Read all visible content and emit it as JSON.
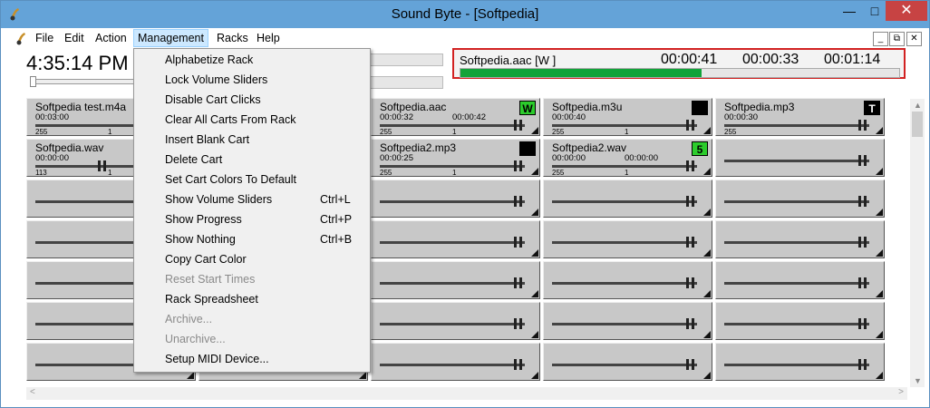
{
  "window": {
    "title": "Sound Byte - [Softpedia]"
  },
  "menubar": {
    "items": [
      "File",
      "Edit",
      "Action",
      "Management",
      "Racks",
      "Help"
    ]
  },
  "clock": {
    "time": "4:35:14 PM"
  },
  "now_playing": {
    "filename": "Softpedia.aac  [W ]",
    "elapsed": "00:00:41",
    "remaining": "00:00:33",
    "duration": "00:01:14",
    "progress": 0.55,
    "progress_color": "#12a33a",
    "border_color": "#d22222"
  },
  "management_menu": {
    "items": [
      {
        "label": "Alphabetize Rack",
        "shortcut": "",
        "enabled": true
      },
      {
        "label": "Lock Volume Sliders",
        "shortcut": "",
        "enabled": true
      },
      {
        "label": "Disable Cart Clicks",
        "shortcut": "",
        "enabled": true
      },
      {
        "label": "Clear All Carts From Rack",
        "shortcut": "",
        "enabled": true
      },
      {
        "label": "Insert Blank Cart",
        "shortcut": "",
        "enabled": true
      },
      {
        "label": "Delete Cart",
        "shortcut": "",
        "enabled": true
      },
      {
        "label": "Set Cart Colors To Default",
        "shortcut": "",
        "enabled": true
      },
      {
        "label": "Show Volume Sliders",
        "shortcut": "Ctrl+L",
        "enabled": true
      },
      {
        "label": "Show Progress",
        "shortcut": "Ctrl+P",
        "enabled": true
      },
      {
        "label": "Show Nothing",
        "shortcut": "Ctrl+B",
        "enabled": true
      },
      {
        "label": "Copy Cart Color",
        "shortcut": "",
        "enabled": true
      },
      {
        "label": "Reset Start Times",
        "shortcut": "",
        "enabled": false
      },
      {
        "label": "Rack Spreadsheet",
        "shortcut": "",
        "enabled": true
      },
      {
        "label": "Archive...",
        "shortcut": "",
        "enabled": false
      },
      {
        "label": "Unarchive...",
        "shortcut": "",
        "enabled": false
      },
      {
        "label": "Setup MIDI Device...",
        "shortcut": "",
        "enabled": true
      }
    ]
  },
  "carts": [
    {
      "name": "Softpedia test.m4a",
      "t1": "00:03:00",
      "t2": "",
      "vmin": "255",
      "vmax": "1",
      "badge": ""
    },
    {
      "name": "Softpedia.aac",
      "t1": "00:00:32",
      "t2": "00:00:42",
      "vmin": "255",
      "vmax": "1",
      "badge": "W",
      "badge_color": "#2ccc2c"
    },
    {
      "name": "Softpedia.m3u",
      "t1": "00:00:40",
      "t2": "",
      "vmin": "255",
      "vmax": "1",
      "badge": "",
      "badge_color": "#000000"
    },
    {
      "name": "Softpedia.mp3",
      "t1": "00:00:30",
      "t2": "",
      "vmin": "255",
      "vmax": "",
      "badge": "T",
      "badge_color": "#000000"
    },
    {
      "name": "Softpedia.wav",
      "t1": "00:00:00",
      "t2": "",
      "vmin": "113",
      "vmax": "1",
      "badge": ""
    },
    {
      "name": "Softpedia2.mp3",
      "t1": "00:00:25",
      "t2": "",
      "vmin": "255",
      "vmax": "1",
      "badge": "",
      "badge_color": "#000000"
    },
    {
      "name": "Softpedia2.wav",
      "t1": "00:00:00",
      "t2": "00:00:00",
      "vmin": "255",
      "vmax": "1",
      "badge": "5",
      "badge_color": "#2ccc2c"
    }
  ]
}
